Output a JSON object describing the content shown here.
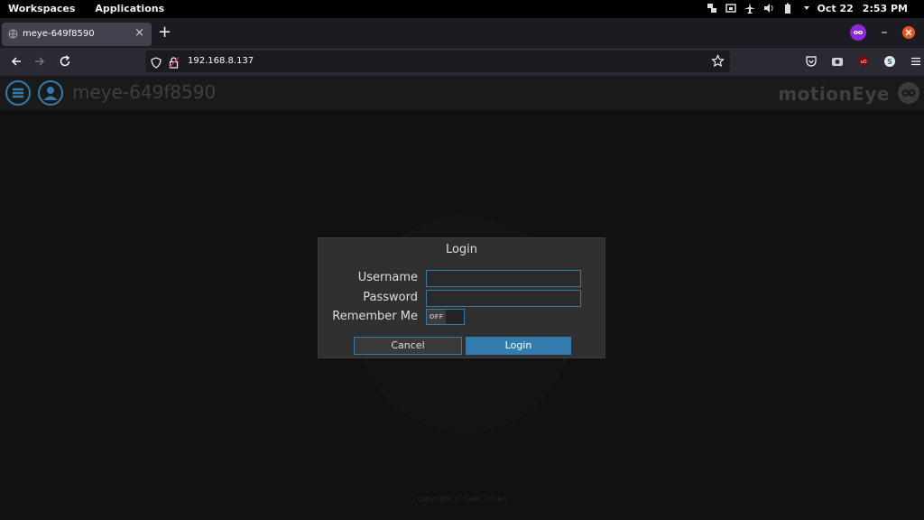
{
  "topbar": {
    "workspaces": "Workspaces",
    "applications": "Applications",
    "tray_icons": [
      "network-icon",
      "wired-icon",
      "airplane-icon",
      "volume-icon",
      "battery-icon",
      "chevron-down-icon"
    ],
    "date": "Oct 22",
    "time": "2:53 PM"
  },
  "browser": {
    "tab_title": "meye-649f8590",
    "url": "192.168.8.137"
  },
  "app": {
    "hostname": "meye-649f8590",
    "brand": "motionEye",
    "footer": "copyright © Calin Crisan"
  },
  "login": {
    "title": "Login",
    "username_label": "Username",
    "password_label": "Password",
    "remember_label": "Remember Me",
    "username_value": "",
    "password_value": "",
    "remember_state": "OFF",
    "cancel_label": "Cancel",
    "login_label": "Login"
  },
  "colors": {
    "accent": "#317cad",
    "dialog_bg": "#303030",
    "page_bg": "#111111"
  }
}
